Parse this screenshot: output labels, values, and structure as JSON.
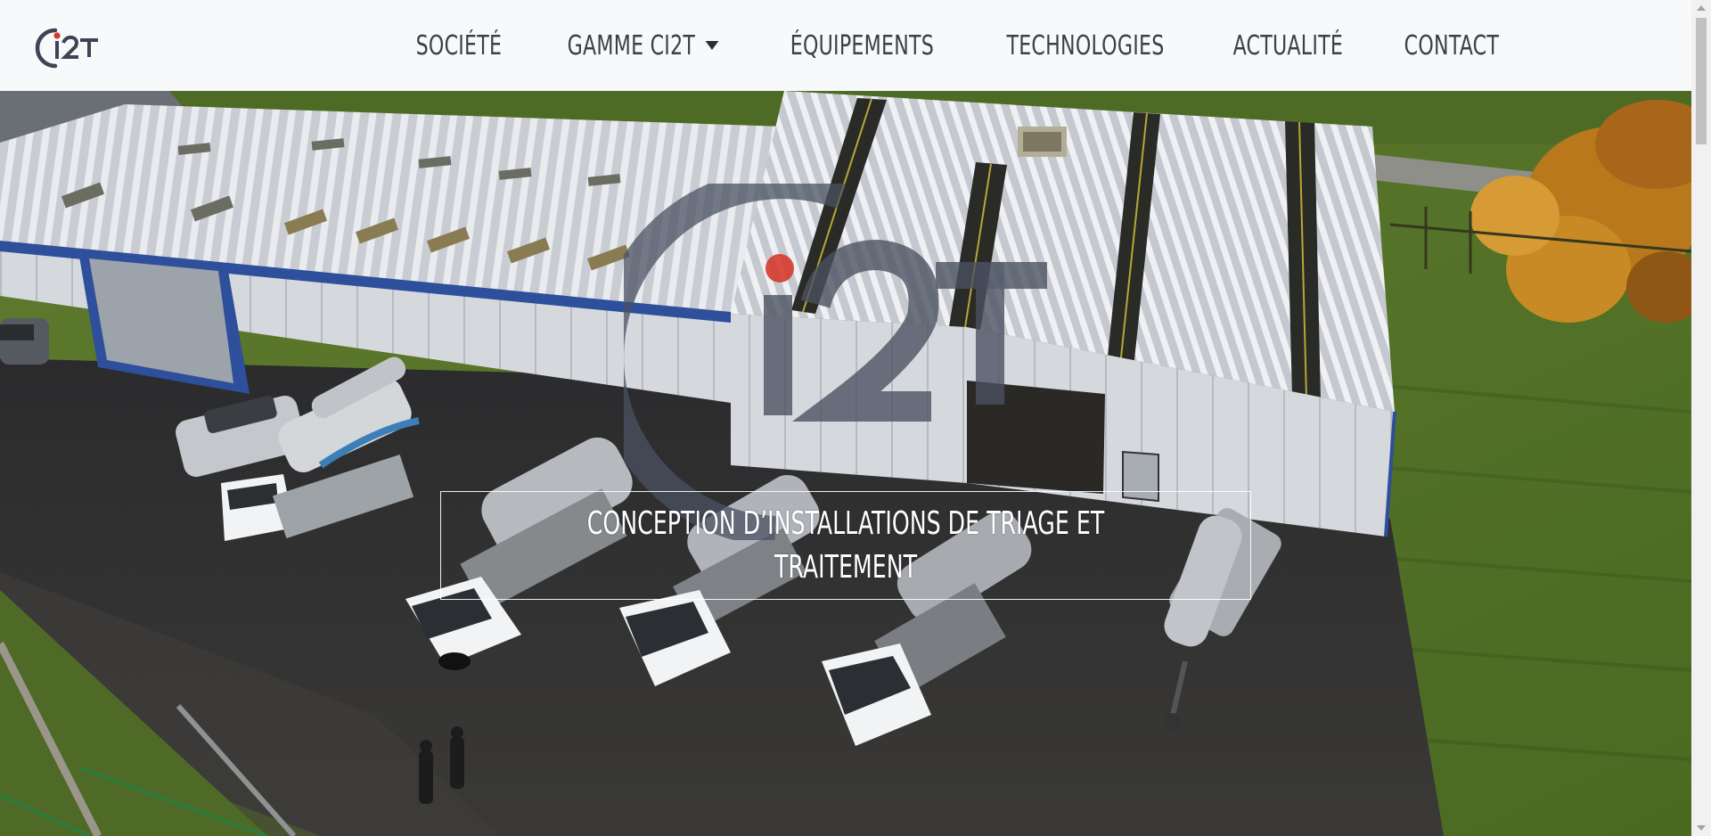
{
  "navbar": {
    "brand": {
      "logo_text": "ci2T",
      "icon": "ci2t-logo"
    },
    "items": [
      {
        "label": "SOCIÉTÉ"
      },
      {
        "label": "GAMME CI2T",
        "has_dropdown": true
      },
      {
        "label": "ÉQUIPEMENTS"
      },
      {
        "label": "TECHNOLOGIES"
      },
      {
        "label": "ACTUALITÉ"
      },
      {
        "label": "CONTACT"
      }
    ]
  },
  "hero": {
    "caption": "CONCEPTION D’INSTALLATIONS DE TRIAGE ET TRAITEMENT",
    "watermark_logo": "ci2T",
    "background": "aerial-photo-factory-trucks"
  },
  "colors": {
    "navbar_bg": "#f8f9fa",
    "nav_text": "#3b3f46",
    "logo_gray": "#4a5161",
    "logo_red": "#d6382a",
    "caption_text": "#ffffff"
  }
}
